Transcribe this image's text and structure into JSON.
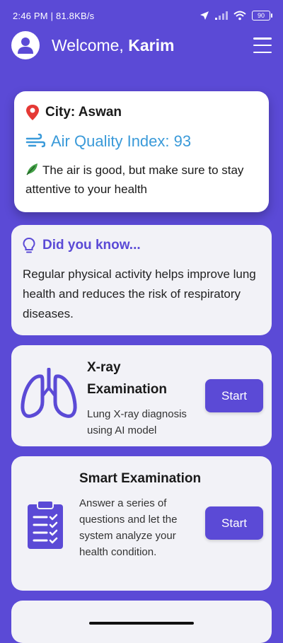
{
  "status_bar": {
    "time_speed": "2:46 PM | 81.8KB/s",
    "battery": "90"
  },
  "header": {
    "welcome_prefix": "Welcome,",
    "user_name": "Karim"
  },
  "air_card": {
    "city_label": "City: Aswan",
    "aqi_label": "Air Quality Index: 93",
    "note": "The air is good, but make sure to stay attentive to your health",
    "aqi_color": "#3a9ad9"
  },
  "tip_card": {
    "title": "Did you know...",
    "body": "Regular physical activity helps improve lung health and reduces the risk of respiratory diseases."
  },
  "exams": [
    {
      "title": "X-ray Examination",
      "description": "Lung X-ray diagnosis using AI model",
      "button": "Start",
      "icon": "lungs-icon"
    },
    {
      "title": "Smart Examination",
      "description": "Answer a series of questions and let the system analyze your health condition.",
      "button": "Start",
      "icon": "clipboard-checklist-icon"
    }
  ],
  "colors": {
    "primary": "#5b4ad6",
    "card_bg": "#f2f2f7"
  }
}
